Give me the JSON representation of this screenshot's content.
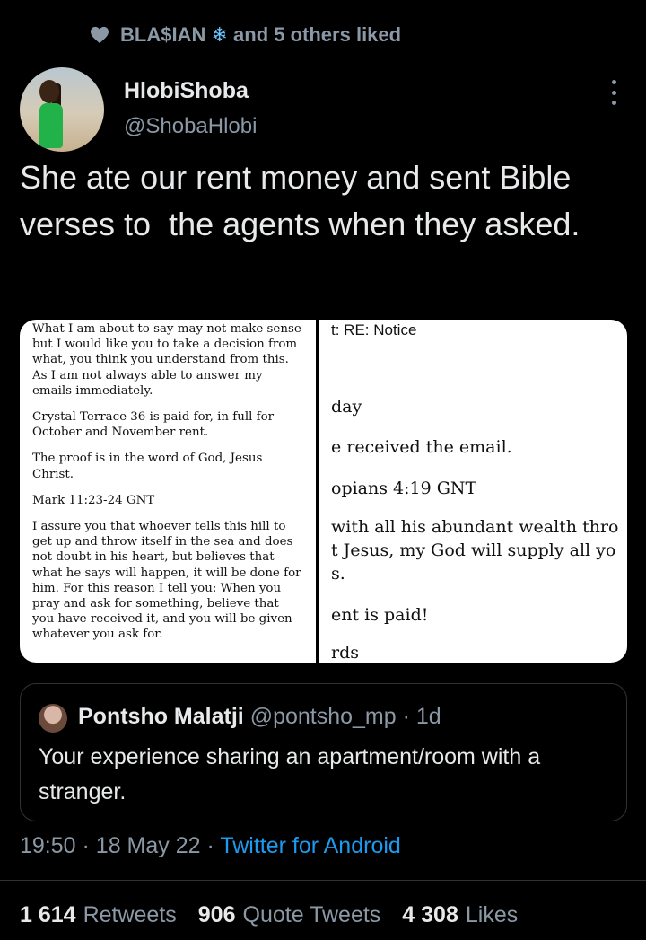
{
  "social_context": {
    "text_prefix": "BLA$IAN",
    "emoji": "❄",
    "text_suffix": "and 5 others liked",
    "icons": [
      "heart-icon",
      "snowflake-icon"
    ]
  },
  "author": {
    "display_name": "HlobiShoba",
    "handle": "@ShobaHlobi"
  },
  "tweet": {
    "text": "She ate our rent money and sent Bible verses to  the agents when they asked."
  },
  "media": {
    "left_paragraphs": [
      "What I am about to say may not make sense but I would like you to take a decision from what, you think you understand from this. As I am not always able to answer my emails immediately.",
      "Crystal Terrace 36 is paid for, in full for October and November rent.",
      "The proof is in the word of God, Jesus Christ.",
      "Mark 11:23-24 GNT",
      "I assure you that whoever tells this hill to get up and throw itself in the sea and does not doubt in his heart, but believes that what he says will happen, it will be done for him. For this reason I tell you: When you pray and ask for something, believe that you have received it, and you will be given whatever you ask for."
    ],
    "right_lines": [
      "t: RE: Notice",
      "day",
      "e received the email.",
      "opians 4:19 GNT",
      "with all his abundant wealth thro",
      "t Jesus, my God will supply all yo",
      "s.",
      "ent is paid!",
      "rds"
    ]
  },
  "quote": {
    "name": "Pontsho Malatji",
    "handle": "@pontsho_mp",
    "separator": "·",
    "time": "1d",
    "text": "Your experience sharing an apartment/room with a stranger."
  },
  "meta": {
    "time": "19:50",
    "date": "18 May 22",
    "separator": "·",
    "source": "Twitter for Android"
  },
  "stats": {
    "retweets_count": "1 614",
    "retweets_label": "Retweets",
    "quotes_count": "906",
    "quotes_label": "Quote Tweets",
    "likes_count": "4 308",
    "likes_label": "Likes"
  },
  "colors": {
    "background": "#000000",
    "primary_text": "#e7e9ea",
    "secondary_text": "#8b98a5",
    "link": "#1d9bf0",
    "border": "#2f3336"
  }
}
